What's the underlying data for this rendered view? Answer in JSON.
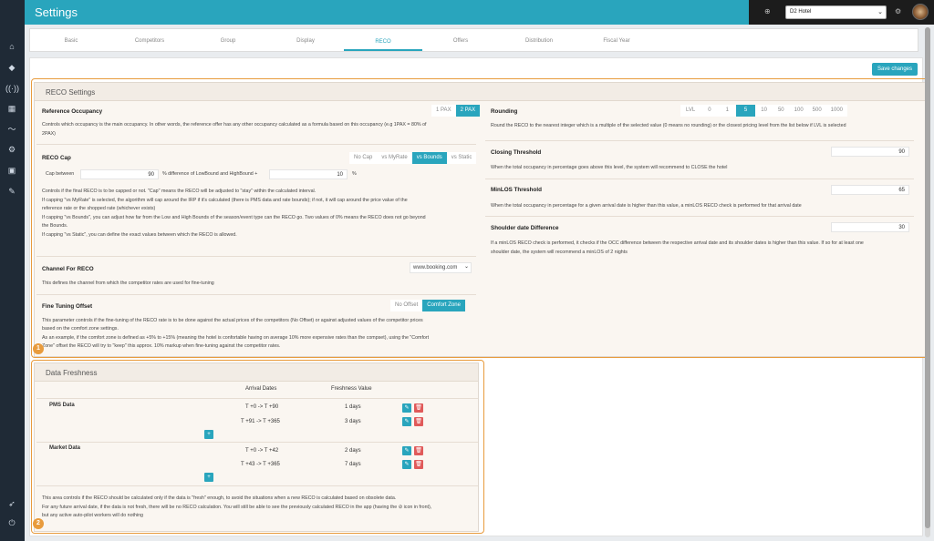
{
  "header": {
    "title": "Settings",
    "hotel_select": "D2 Hotel"
  },
  "sidebar_icons": [
    "home-icon",
    "diamond-icon",
    "broadcast-icon",
    "table-icon",
    "chart-line-icon",
    "gear-icon",
    "image-icon",
    "wrench-icon",
    "rocket-icon",
    "power-icon"
  ],
  "tabs": [
    "Basic",
    "Competitors",
    "Group",
    "Display",
    "RECO",
    "Offers",
    "Distribution",
    "Fiscal Year"
  ],
  "save_label": "Save changes",
  "reco": {
    "title": "RECO Settings",
    "reference_occupancy": {
      "label": "Reference Occupancy",
      "options": [
        "1 PAX",
        "2 PAX"
      ],
      "selected": "2 PAX",
      "desc_line1": "Controls which occupancy is the main occupancy. In other words, the reference offer has any other occupancy calculated as a formula based on this occupancy (e.g 1PAX = 80% of",
      "desc_line2": "2PAX)"
    },
    "reco_cap": {
      "label": "RECO Cap",
      "options": [
        "No Cap",
        "vs MyRate",
        "vs Bounds",
        "vs Static"
      ],
      "selected": "vs Bounds",
      "cap_between_label": "Cap between",
      "cap_between_value": "90",
      "mid_label": "% difference of LowBound and HighBound +",
      "second_value": "10",
      "pct": "%",
      "desc": [
        "Controls if the final RECO is to be capped or not. \"Cap\" means the RECO will be adjusted to \"stay\" within the calculated interval.",
        "If capping \"vs MyRate\" is selected, the algorithm will cap around the IRP if it's calculated (there is PMS data and rate bounds); if not, it will cap around the price value of the",
        "reference rate or the shopped rate (whichever exists)",
        "If capping \"vs Bounds\", you can adjust how far from the Low and High Bounds of the season/event type can the RECO go. Two values of 0% means the RECO does not go beyond",
        "the Bounds.",
        "If capping \"vs Static\", you can define the exact values between which the RECO is allowed."
      ]
    },
    "channel": {
      "label": "Channel For RECO",
      "value": "www.booking.com",
      "desc": "This defines the channel from which the competitor rates are used for fine-tuning"
    },
    "fine_tuning": {
      "label": "Fine Tuning Offset",
      "options": [
        "No Offset",
        "Comfort Zone"
      ],
      "selected": "Comfort Zone",
      "desc": [
        "This parameter controls if the fine-tuning of the RECO rate is to be done against the actual prices of the competitors (No Offset) or against adjusted values of the competitor prices",
        "based on the comfort zone settings.",
        "As an example, if the comfort zone is defined as +5% to +15% (meaning the hotel is confortable having on average 10% more expensive rates than the compset), using the \"Comfort",
        "Zone\" offset the RECO will try to \"keep\" this approx. 10% markup when fine-tuning against the competitor rates."
      ]
    },
    "rounding": {
      "label": "Rounding",
      "options": [
        "LVL",
        "0",
        "1",
        "5",
        "10",
        "50",
        "100",
        "500",
        "1000"
      ],
      "selected": "5",
      "desc": "Round the RECO to the nearest integer which is a multiple of the selected value (0 means no rounding) or the closest pricing level from the list below if LVL is selected"
    },
    "closing_threshold": {
      "label": "Closing Threshold",
      "value": "90",
      "desc": "When the total occupancy in percentage goes above this level, the system will recommend to CLOSE the hotel"
    },
    "minlos_threshold": {
      "label": "MinLOS Threshold",
      "value": "65",
      "desc": "When the total occupancy in percentage for a given arrival date is higher than this value, a minLOS RECO check is performed for that arrival date"
    },
    "shoulder": {
      "label": "Shoulder date Difference",
      "value": "30",
      "desc_line1": "If a minLOS RECO check is performed, it checks if the OCC difference between the respective arrival date and its shoulder dates is higher than this value. If so for at least one",
      "desc_line2": "shoulder date, the system will recommend a minLOS of 2 nights"
    }
  },
  "freshness": {
    "title": "Data Freshness",
    "col_arrival": "Arrival Dates",
    "col_value": "Freshness Value",
    "pms_label": "PMS Data",
    "market_label": "Market Data",
    "pms_rows": [
      {
        "arrival": "T +0 -> T +90",
        "value": "1 days"
      },
      {
        "arrival": "T +91 -> T +365",
        "value": "3 days"
      }
    ],
    "market_rows": [
      {
        "arrival": "T +0 -> T +42",
        "value": "2 days"
      },
      {
        "arrival": "T +43 -> T +365",
        "value": "7 days"
      }
    ],
    "desc": [
      "This area controls if the RECO should be calculated only if the data is \"fresh\" enough, to avoid the situations when a new RECO is calculated based on obsolete data.",
      "For any future arrival date, if the data is not fresh, there will be no RECO calculation. You will still be able to see the previously calculated RECO in the app (having the ⊘ icon in front),",
      "but any active auto-pilot workers will do nothing"
    ]
  },
  "badges": [
    "1",
    "2"
  ]
}
